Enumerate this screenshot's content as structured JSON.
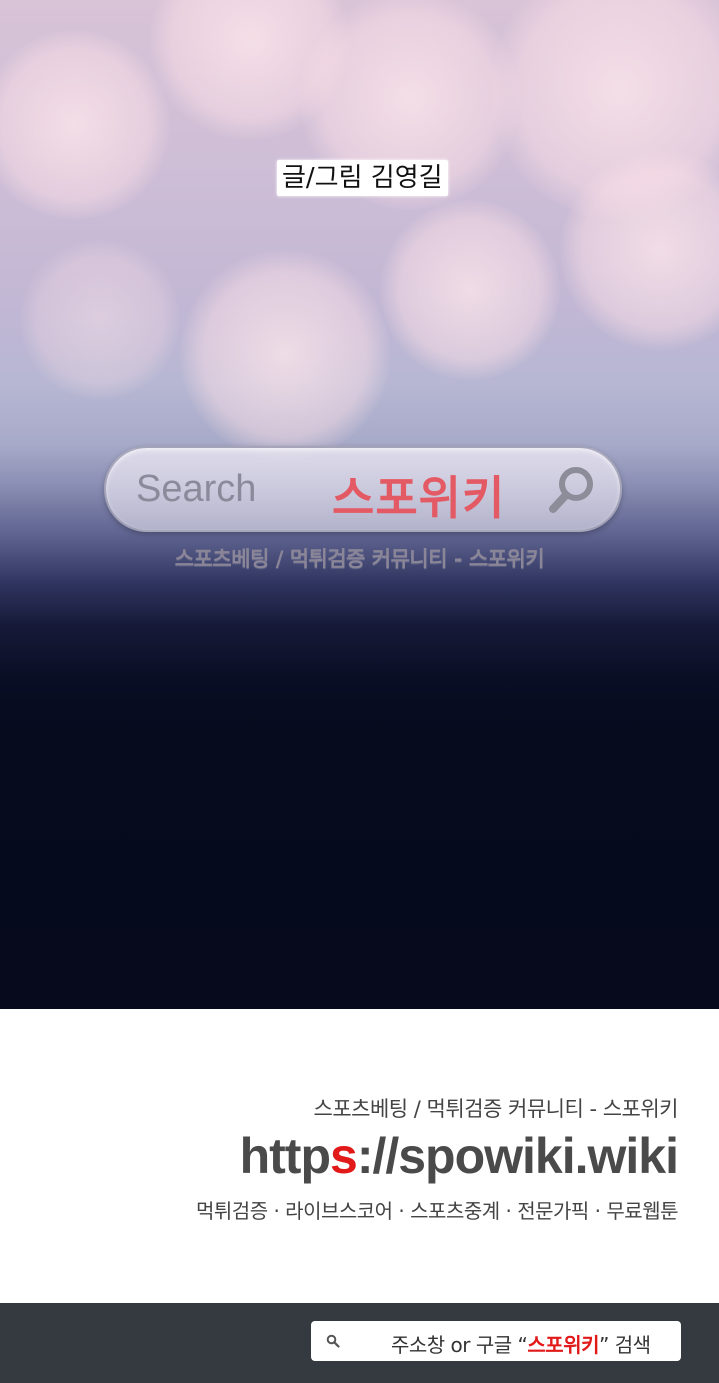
{
  "hero": {
    "credit": "글/그림 김영길",
    "search_word": "Search",
    "search_brand": "스포위키",
    "tagline": "스포츠베팅 / 먹튀검증 커뮤니티 - 스포위키"
  },
  "promo": {
    "tagline": "스포츠베팅 / 먹튀검증 커뮤니티 - 스포위키",
    "url_part1": "http",
    "url_red": "s",
    "url_part2": "://spowiki.wiki",
    "services": "먹튀검증 · 라이브스코어 · 스포츠중계 · 전문가픽 · 무료웹툰"
  },
  "bottom": {
    "prefix": "주소창 or 구글 ",
    "open_quote": "“",
    "brand": "스포위키",
    "close_quote": "”",
    "suffix": " 검색"
  },
  "colors": {
    "accent_red": "#e11919",
    "brand_pink": "#e45a64",
    "dark_navy": "#060a1c",
    "bar_gray": "#353a40"
  },
  "icons": [
    "search-icon",
    "magnifier-icon"
  ]
}
